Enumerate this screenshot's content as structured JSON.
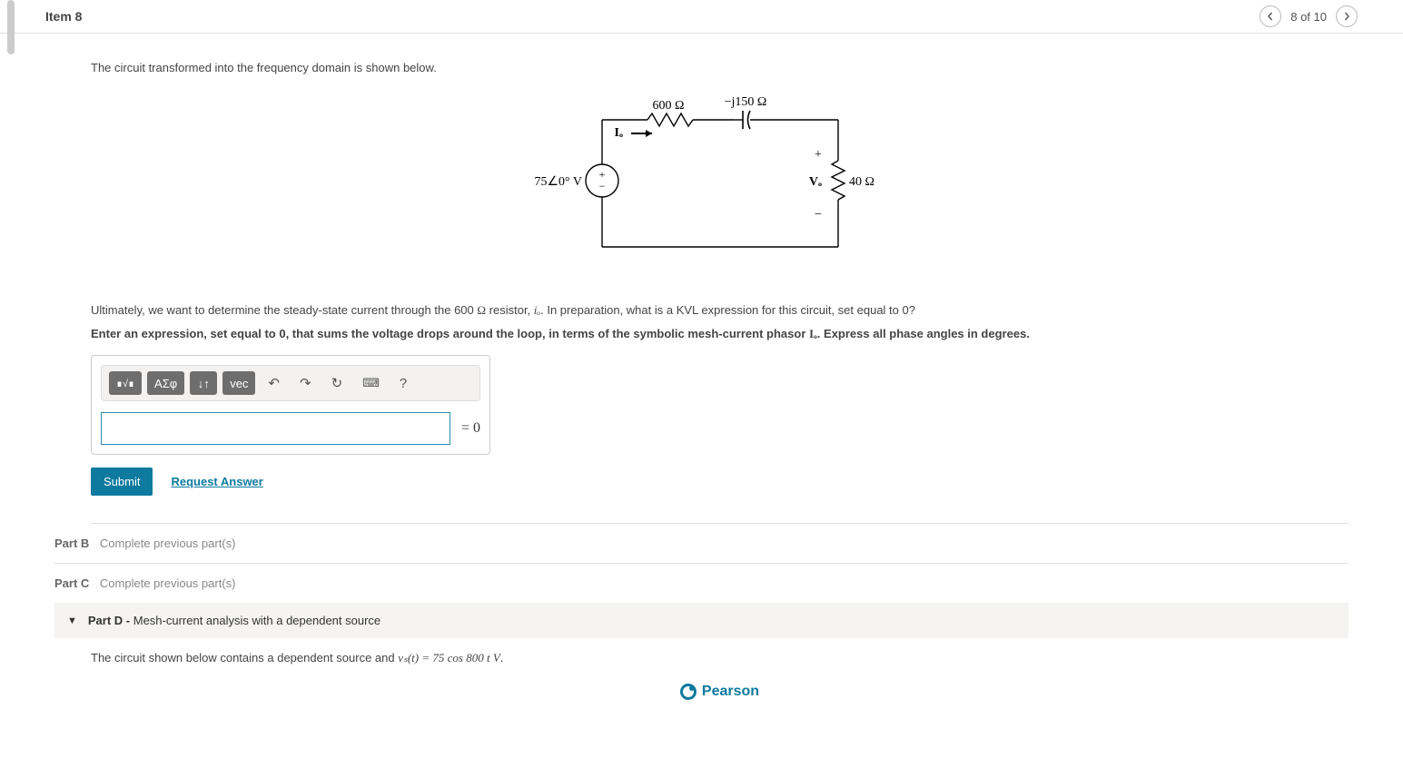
{
  "header": {
    "item_title": "Item 8",
    "counter": "8 of 10"
  },
  "intro": "The circuit transformed into the frequency domain is shown below.",
  "circuit": {
    "source_label": "75∠0° V",
    "current_label": "Iₒ",
    "r1_label": "600 Ω",
    "c_label": "−j150 Ω",
    "vo_label": "Vₒ",
    "r2_label": "40 Ω",
    "plus": "+",
    "minus": "−"
  },
  "question": {
    "line1_a": "Ultimately, we want to determine the steady-state current through the 600 ",
    "line1_b": " resistor, ",
    "line1_c": ". In preparation, what is a KVL expression for this circuit, set equal to 0?",
    "line2_a": "Enter an expression, set equal to 0, that sums the voltage drops around the loop, in terms of the symbolic mesh-current phasor ",
    "line2_b": ". Express all phase angles in degrees.",
    "ohm": "Ω",
    "io": "iₒ",
    "Io": "Iₒ"
  },
  "toolbar": {
    "templates_label": "∎√∎",
    "greek_label": "ΑΣφ",
    "subscript_label": "↓↑",
    "vec_label": "vec",
    "undo_label": "↶",
    "redo_label": "↷",
    "reset_label": "↻",
    "keyboard_label": "⌨",
    "help_label": "?"
  },
  "equals_zero": "= 0",
  "actions": {
    "submit_label": "Submit",
    "request_label": "Request Answer"
  },
  "parts": {
    "b": {
      "label": "Part B",
      "text": "Complete previous part(s)"
    },
    "c": {
      "label": "Part C",
      "text": "Complete previous part(s)"
    },
    "d": {
      "label": "Part D -",
      "title": " Mesh-current analysis with a dependent source",
      "body_a": "The circuit shown below contains a dependent source and ",
      "body_b": "vₛ(t) = 75 cos 800 t V",
      "body_c": "."
    }
  },
  "footer": {
    "brand": "Pearson"
  }
}
